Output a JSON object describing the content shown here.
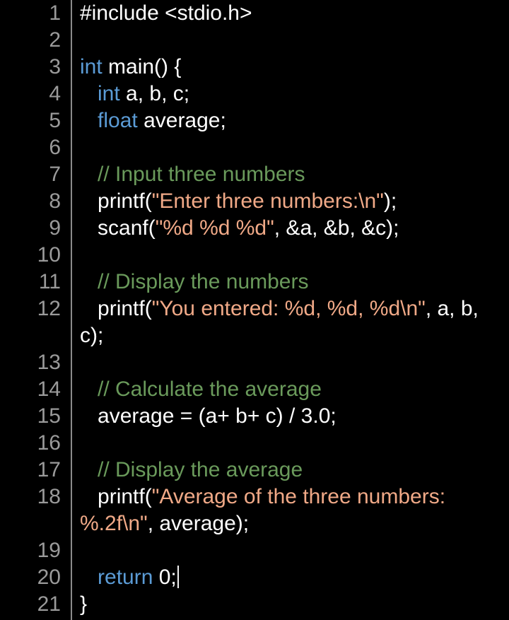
{
  "editor": {
    "theme_colors": {
      "background": "#000000",
      "keyword": "#5b9bd5",
      "string": "#f0a987",
      "comment": "#6a9a5b",
      "plain": "#ffffff",
      "line_number": "#9a9a9a"
    },
    "lines": [
      {
        "num": "1",
        "tokens": [
          {
            "t": "pre",
            "v": "#include <stdio.h>"
          }
        ]
      },
      {
        "num": "2",
        "tokens": []
      },
      {
        "num": "3",
        "tokens": [
          {
            "t": "keyword",
            "v": "int"
          },
          {
            "t": "plain",
            "v": " main() {"
          }
        ]
      },
      {
        "num": "4",
        "tokens": [
          {
            "t": "plain",
            "v": "   "
          },
          {
            "t": "keyword",
            "v": "int"
          },
          {
            "t": "plain",
            "v": " a, b, c;"
          }
        ]
      },
      {
        "num": "5",
        "tokens": [
          {
            "t": "plain",
            "v": "   "
          },
          {
            "t": "keyword",
            "v": "float"
          },
          {
            "t": "plain",
            "v": " average;"
          }
        ]
      },
      {
        "num": "6",
        "tokens": []
      },
      {
        "num": "7",
        "tokens": [
          {
            "t": "plain",
            "v": "   "
          },
          {
            "t": "comment",
            "v": "// Input three numbers"
          }
        ]
      },
      {
        "num": "8",
        "tokens": [
          {
            "t": "plain",
            "v": "   printf("
          },
          {
            "t": "string",
            "v": "\"Enter three numbers:\\n\""
          },
          {
            "t": "plain",
            "v": ");"
          }
        ]
      },
      {
        "num": "9",
        "tokens": [
          {
            "t": "plain",
            "v": "   scanf("
          },
          {
            "t": "string",
            "v": "\"%d %d %d\""
          },
          {
            "t": "plain",
            "v": ", &a, &b, &c);"
          }
        ]
      },
      {
        "num": "10",
        "tokens": []
      },
      {
        "num": "11",
        "tokens": [
          {
            "t": "plain",
            "v": "   "
          },
          {
            "t": "comment",
            "v": "// Display the numbers"
          }
        ]
      },
      {
        "num": "12",
        "wrap": true,
        "tokens": [
          {
            "t": "plain",
            "v": "   printf("
          },
          {
            "t": "string",
            "v": "\"You entered: %d, %d, %d\\n\""
          },
          {
            "t": "plain",
            "v": ", a, b, c);"
          }
        ]
      },
      {
        "num": "13",
        "tokens": []
      },
      {
        "num": "14",
        "tokens": [
          {
            "t": "plain",
            "v": "   "
          },
          {
            "t": "comment",
            "v": "// Calculate the average"
          }
        ]
      },
      {
        "num": "15",
        "tokens": [
          {
            "t": "plain",
            "v": "   average = (a+ b+ c) / 3.0;"
          }
        ]
      },
      {
        "num": "16",
        "tokens": []
      },
      {
        "num": "17",
        "tokens": [
          {
            "t": "plain",
            "v": "   "
          },
          {
            "t": "comment",
            "v": "// Display the average"
          }
        ]
      },
      {
        "num": "18",
        "wrap": true,
        "tokens": [
          {
            "t": "plain",
            "v": "   printf("
          },
          {
            "t": "string",
            "v": "\"Average of the three numbers: %.2f\\n\""
          },
          {
            "t": "plain",
            "v": ", average);"
          }
        ]
      },
      {
        "num": "19",
        "tokens": []
      },
      {
        "num": "20",
        "caret": true,
        "tokens": [
          {
            "t": "plain",
            "v": "   "
          },
          {
            "t": "keyword",
            "v": "return"
          },
          {
            "t": "plain",
            "v": " 0;"
          }
        ]
      },
      {
        "num": "21",
        "tokens": [
          {
            "t": "plain",
            "v": "}"
          }
        ]
      }
    ]
  }
}
